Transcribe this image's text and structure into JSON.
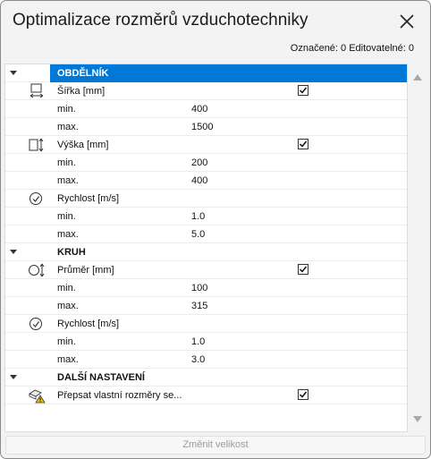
{
  "window": {
    "title": "Optimalizace rozměrů vzduchotechniky",
    "counter": "Označené: 0 Editovatelné: 0"
  },
  "sections": {
    "rect": {
      "header": "OBDĚLNÍK",
      "width_label": "Šířka [mm]",
      "width_checked": true,
      "width_min_label": "min.",
      "width_min": "400",
      "width_max_label": "max.",
      "width_max": "1500",
      "height_label": "Výška [mm]",
      "height_checked": true,
      "height_min_label": "min.",
      "height_min": "200",
      "height_max_label": "max.",
      "height_max": "400",
      "speed_label": "Rychlost [m/s]",
      "speed_min_label": "min.",
      "speed_min": "1.0",
      "speed_max_label": "max.",
      "speed_max": "5.0"
    },
    "circle": {
      "header": "KRUH",
      "diameter_label": "Průměr [mm]",
      "diameter_checked": true,
      "diameter_min_label": "min.",
      "diameter_min": "100",
      "diameter_max_label": "max.",
      "diameter_max": "315",
      "speed_label": "Rychlost [m/s]",
      "speed_min_label": "min.",
      "speed_min": "1.0",
      "speed_max_label": "max.",
      "speed_max": "3.0"
    },
    "other": {
      "header": "DALŠÍ NASTAVENÍ",
      "override_label": "Přepsat vlastní rozměry se...",
      "override_checked": true
    }
  },
  "footer": {
    "button_label": "Změnit velikost",
    "button_enabled": false
  },
  "colors": {
    "selection": "#0078d7",
    "window_bg": "#f3f3f3",
    "panel_bg": "#ffffff"
  },
  "icons": [
    "width-dimension-icon",
    "height-dimension-icon",
    "speed-gauge-icon",
    "diameter-dimension-icon",
    "warning-icon",
    "close-icon",
    "checkmark-icon"
  ]
}
